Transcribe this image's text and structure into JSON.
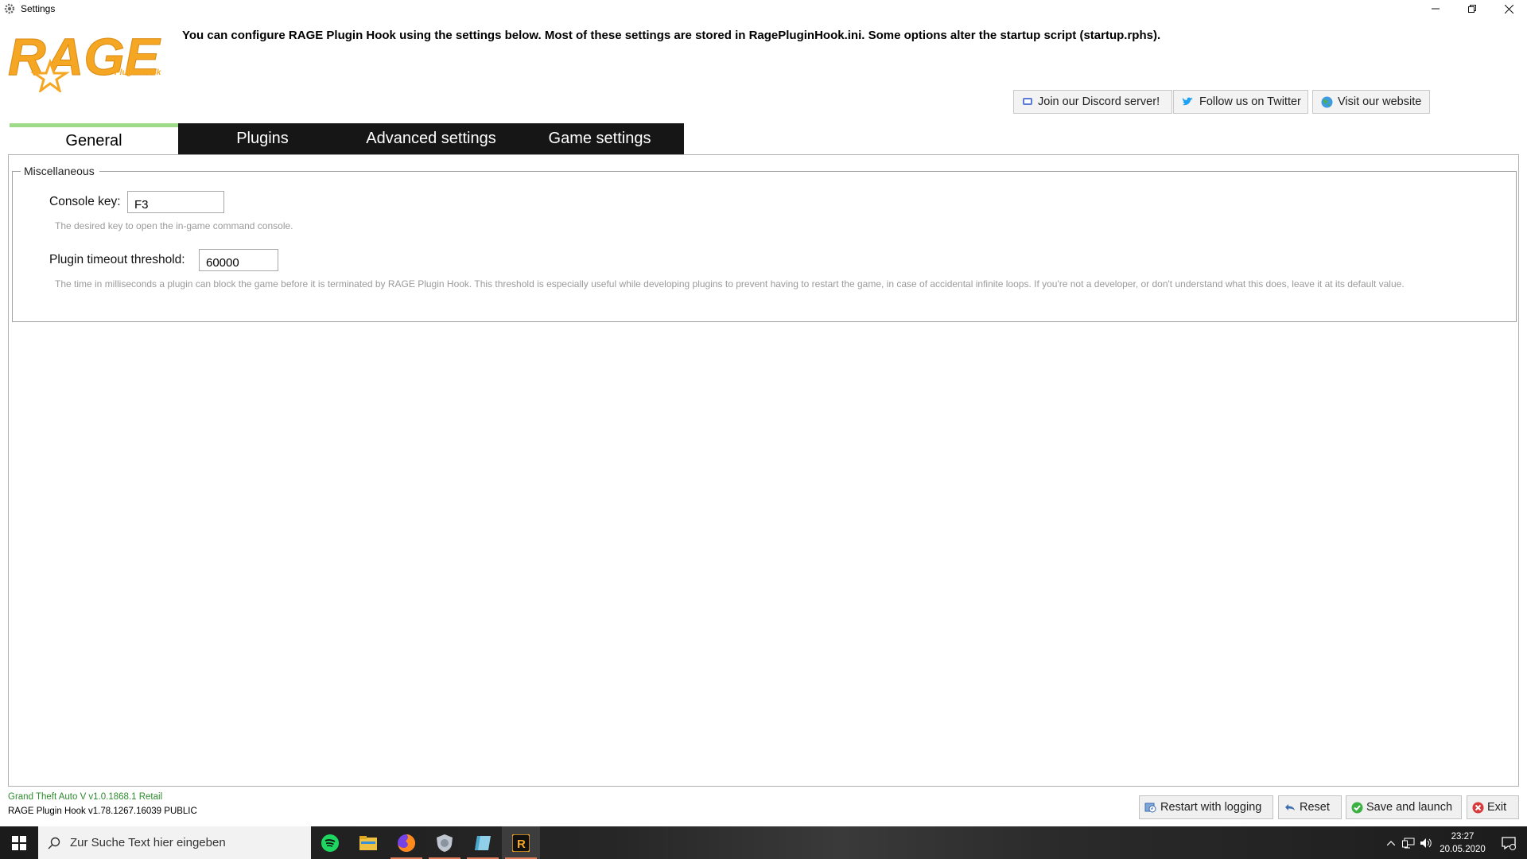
{
  "window": {
    "title": "Settings"
  },
  "header": {
    "logo_text": "RAGE",
    "logo_subtext": "Plugin Hook",
    "description": "You can configure RAGE Plugin Hook using the settings below. Most of these settings are stored in RagePluginHook.ini. Some options alter the startup script (startup.rphs)."
  },
  "social": {
    "discord": "Join our Discord server!",
    "twitter": "Follow us on Twitter",
    "website": "Visit our website"
  },
  "tabs": [
    {
      "label": "General",
      "active": true
    },
    {
      "label": "Plugins",
      "active": false
    },
    {
      "label": "Advanced settings",
      "active": false
    },
    {
      "label": "Game settings",
      "active": false
    }
  ],
  "general": {
    "group_title": "Miscellaneous",
    "console_key": {
      "label": "Console key:",
      "value": "F3",
      "description": "The desired key to open the in-game command console."
    },
    "plugin_timeout": {
      "label": "Plugin timeout threshold:",
      "value": "60000",
      "description": "The time in milliseconds a plugin can block the game before it is terminated by RAGE Plugin Hook. This threshold is especially useful while developing plugins to prevent having to restart the game, in case of accidental infinite loops. If you're not a developer, or don't understand what this does, leave it at its default value."
    }
  },
  "status": {
    "game_version": "Grand Theft Auto V v1.0.1868.1 Retail",
    "hook_version": "RAGE Plugin Hook v1.78.1267.16039 PUBLIC"
  },
  "buttons": {
    "restart_logging": "Restart with logging",
    "reset": "Reset",
    "save_launch": "Save and launch",
    "exit": "Exit"
  },
  "taskbar": {
    "search_placeholder": "Zur Suche Text hier eingeben",
    "time": "23:27",
    "date": "20.05.2020"
  },
  "colors": {
    "logo_orange": "#f5a623",
    "tab_active_border": "#9fd98a",
    "tab_bar": "#161616",
    "game_version_green": "#2e8b2e"
  }
}
